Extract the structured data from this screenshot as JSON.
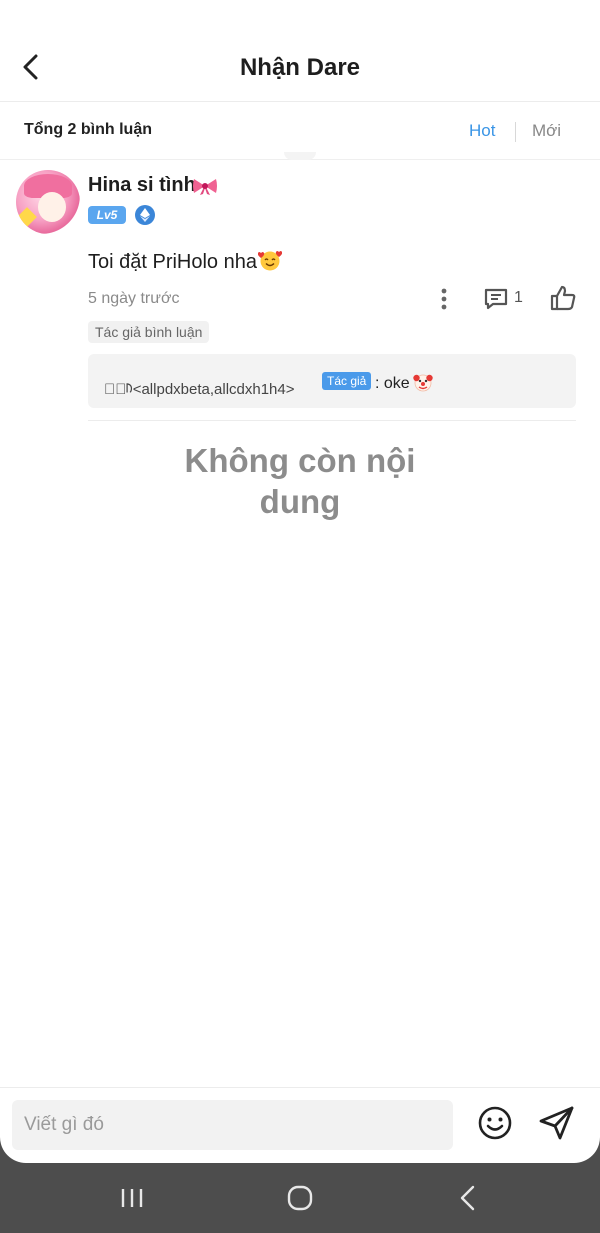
{
  "header": {
    "title": "Nhận Dare"
  },
  "summary": {
    "total_label": "Tổng 2 bình luận",
    "sort_hot": "Hot",
    "sort_new": "Mới"
  },
  "comment": {
    "username": "Hina si tình",
    "level": "Lv5",
    "text": "Toi đặt PriHolo nha",
    "time": "5 ngày trước",
    "reply_count": "1",
    "author_tag": "Tác giả bình luận",
    "reply": {
      "name": "ᡃ⃝ᡕ<allpdxbeta,allcdxh1h4>",
      "author_label": "Tác giả",
      "text": ": oke"
    }
  },
  "empty_state": "Không còn nội dung",
  "input": {
    "placeholder": "Viết gì đó"
  },
  "colors": {
    "accent": "#3a95e6",
    "level_badge": "#5aa6ef",
    "muted_text": "#8a8a8a"
  }
}
